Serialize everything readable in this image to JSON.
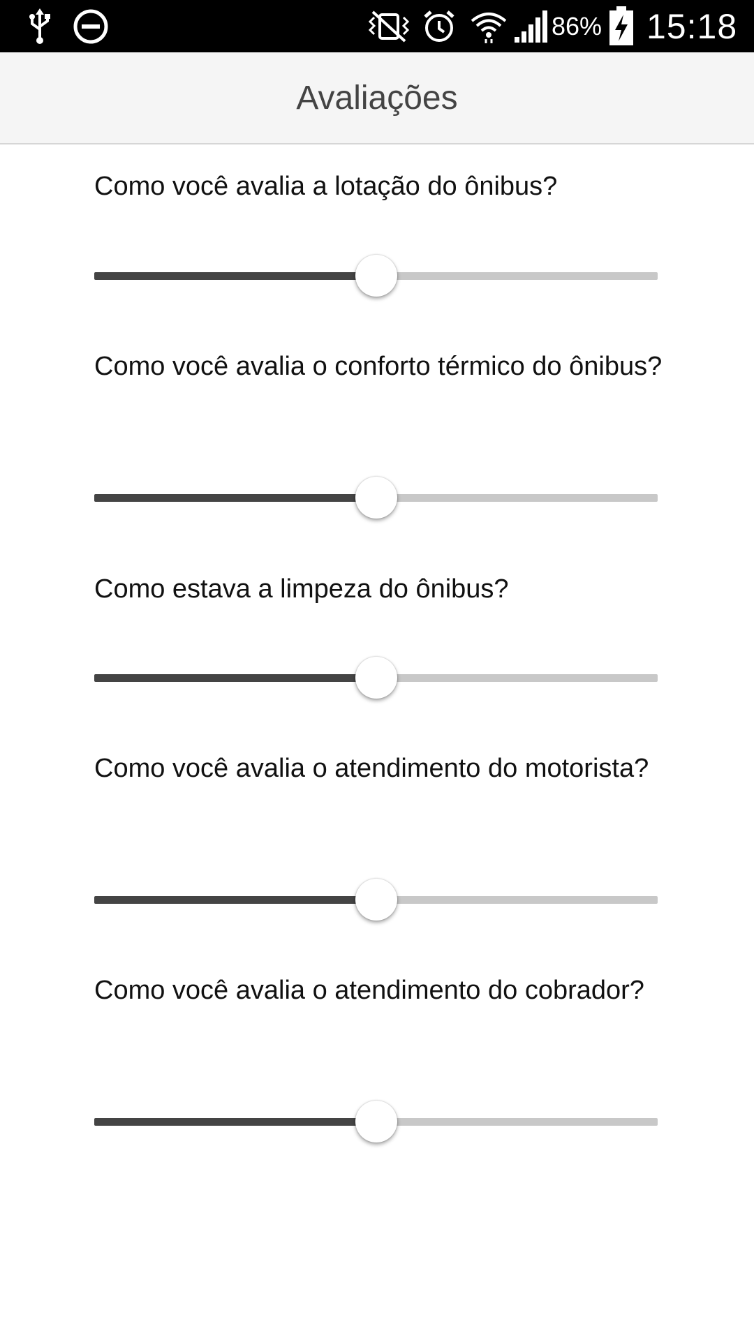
{
  "status_bar": {
    "battery_percent": "86%",
    "time": "15:18",
    "icons": [
      "usb-icon",
      "do-not-disturb-icon",
      "vibrate-mute-icon",
      "alarm-icon",
      "wifi-icon",
      "signal-icon",
      "battery-charging-icon"
    ]
  },
  "app_bar": {
    "title": "Avaliações"
  },
  "questions": [
    {
      "label": "Como você avalia a lotação do ônibus?",
      "value": 0.5
    },
    {
      "label": "Como você avalia o conforto térmico do ônibus?",
      "value": 0.5
    },
    {
      "label": "Como estava a limpeza do ônibus?",
      "value": 0.5
    },
    {
      "label": "Como você avalia o atendimento do motorista?",
      "value": 0.5
    },
    {
      "label": "Como você avalia o atendimento do cobrador?",
      "value": 0.5
    }
  ],
  "colors": {
    "track_filled": "#444444",
    "track_empty": "#c8c8c8",
    "thumb": "#ffffff"
  }
}
